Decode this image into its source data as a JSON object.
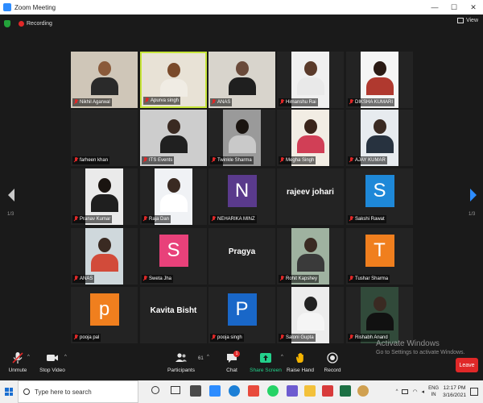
{
  "window": {
    "title": "Zoom Meeting"
  },
  "topbar": {
    "recording_label": "Recording",
    "view_label": "View"
  },
  "grid": {
    "page_left": "1/3",
    "page_right": "1/3",
    "tiles": [
      {
        "name": "Nikhil Agarwal"
      },
      {
        "name": "Apurva singh"
      },
      {
        "name": "ANAS"
      },
      {
        "name": "Himanshu Rai"
      },
      {
        "name": "DIKSHA KUMARI"
      },
      {
        "name": "farheen khan"
      },
      {
        "name": "ITS Events"
      },
      {
        "name": "Twinkle Sharma"
      },
      {
        "name": "Megha Singh"
      },
      {
        "name": "AJAY KUMAR"
      },
      {
        "name": "Pranav Kumar"
      },
      {
        "name": "Raja Dan"
      },
      {
        "name": "NEHARIKA MINZ",
        "avatar": "N",
        "avatar_color": "#5a3a8c"
      },
      {
        "name": "",
        "big_name": "rajeev johari"
      },
      {
        "name": "Sakshi Rawat",
        "avatar": "S",
        "avatar_color": "#1e88d8"
      },
      {
        "name": "ANAS"
      },
      {
        "name": "Sweta Jha",
        "avatar": "S",
        "avatar_color": "#e8417a"
      },
      {
        "name": "",
        "big_name": "Pragya"
      },
      {
        "name": "Rohit Kapshey"
      },
      {
        "name": "Tushar Sharma",
        "avatar": "T",
        "avatar_color": "#f07f1e"
      },
      {
        "name": "pooja pal",
        "avatar": "p",
        "avatar_color": "#f07f1e"
      },
      {
        "name": "",
        "big_name": "Kavita Bisht"
      },
      {
        "name": "pooja singh",
        "avatar": "P",
        "avatar_color": "#1967c8"
      },
      {
        "name": "Saloni Gupta"
      },
      {
        "name": "Rishabh Anand"
      }
    ]
  },
  "toolbar": {
    "unmute": "Unmute",
    "stop_video": "Stop Video",
    "participants": "Participants",
    "participants_count": "61",
    "chat": "Chat",
    "chat_badge": "1",
    "share_screen": "Share Screen",
    "raise_hand": "Raise Hand",
    "record": "Record",
    "leave": "Leave"
  },
  "watermark": {
    "line1": "Activate Windows",
    "line2": "Go to Settings to activate Windows."
  },
  "taskbar": {
    "search_placeholder": "Type here to search",
    "lang1": "ENG",
    "lang2": "IN",
    "time": "12:17 PM",
    "date": "3/16/2021"
  },
  "colors": {
    "accent": "#2d8cff",
    "active_speaker": "#c7e53a",
    "leave": "#e02828",
    "share": "#23d18b"
  }
}
